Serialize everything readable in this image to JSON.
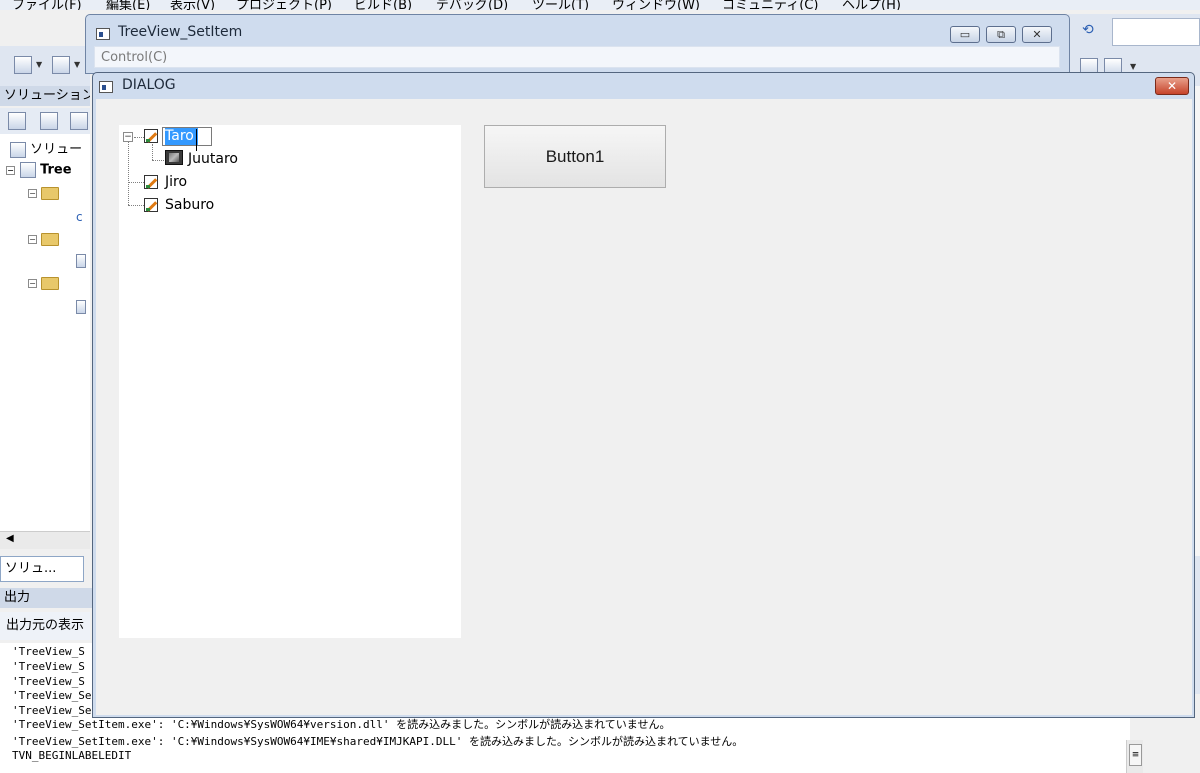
{
  "ide": {
    "menu": [
      "ファイル(F)",
      "編集(E)",
      "表示(V)",
      "プロジェクト(P)",
      "ビルド(B)",
      "デバッグ(D)",
      "ツール(T)",
      "ウィンドウ(W)",
      "コミュニティ(C)",
      "ヘルプ(H)"
    ],
    "solution_explorer": {
      "header": "ソリューション",
      "tree": {
        "root_label": "ソリュー",
        "project_label": "Tree"
      },
      "bottom_tab": "ソリュ..."
    },
    "output": {
      "header": "出力",
      "source_label": "出力元の表示",
      "lines": [
        "'TreeView_S",
        "'TreeView_S",
        "'TreeView_S",
        "'TreeView_Se",
        "'TreeView_Se",
        "'TreeView_SetItem.exe': 'C:¥Windows¥SysWOW64¥version.dll' を読み込みました。シンボルが読み込まれていません。",
        "'TreeView_SetItem.exe': 'C:¥Windows¥SysWOW64¥IME¥shared¥IMJKAPI.DLL' を読み込みました。シンボルが読み込まれていません。",
        "TVN_BEGINLABELEDIT"
      ]
    }
  },
  "main_window": {
    "title": "TreeView_SetItem",
    "menu_item": "Control(C)",
    "buttons": {
      "minimize": "▭",
      "maximize": "⧉",
      "close": "✕"
    }
  },
  "dialog": {
    "title": "DIALOG",
    "close_glyph": "✕",
    "tree": {
      "nodes": [
        {
          "label": "Taro",
          "editing": true
        },
        {
          "label": "Juutaro"
        },
        {
          "label": "Jiro"
        },
        {
          "label": "Saburo"
        }
      ],
      "expander_glyph": "−"
    },
    "button1_label": "Button1"
  },
  "colors": {
    "selection": "#3399ff",
    "dialog_close": "#c7432a",
    "title_bar": "#cfdcee"
  }
}
